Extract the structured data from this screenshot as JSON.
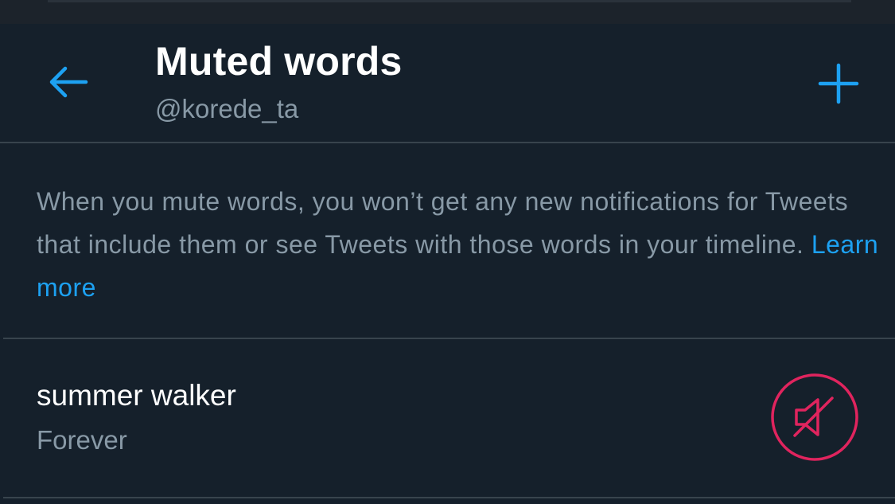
{
  "header": {
    "title": "Muted words",
    "handle": "@korede_ta",
    "back_icon": "arrow-left-icon",
    "add_icon": "plus-icon"
  },
  "info": {
    "text": "When you mute words, you won’t get any new notifications for Tweets that include them or see Tweets with those words in your timeline.",
    "link_label": "Learn more"
  },
  "muted_words": [
    {
      "word": "summer walker",
      "duration": "Forever",
      "action_icon": "speaker-muted-icon"
    }
  ],
  "colors": {
    "background": "#15202b",
    "accent": "#1da1f2",
    "secondary_text": "#8899a6",
    "divider": "#38444d",
    "unmute_red": "#e0245e"
  }
}
